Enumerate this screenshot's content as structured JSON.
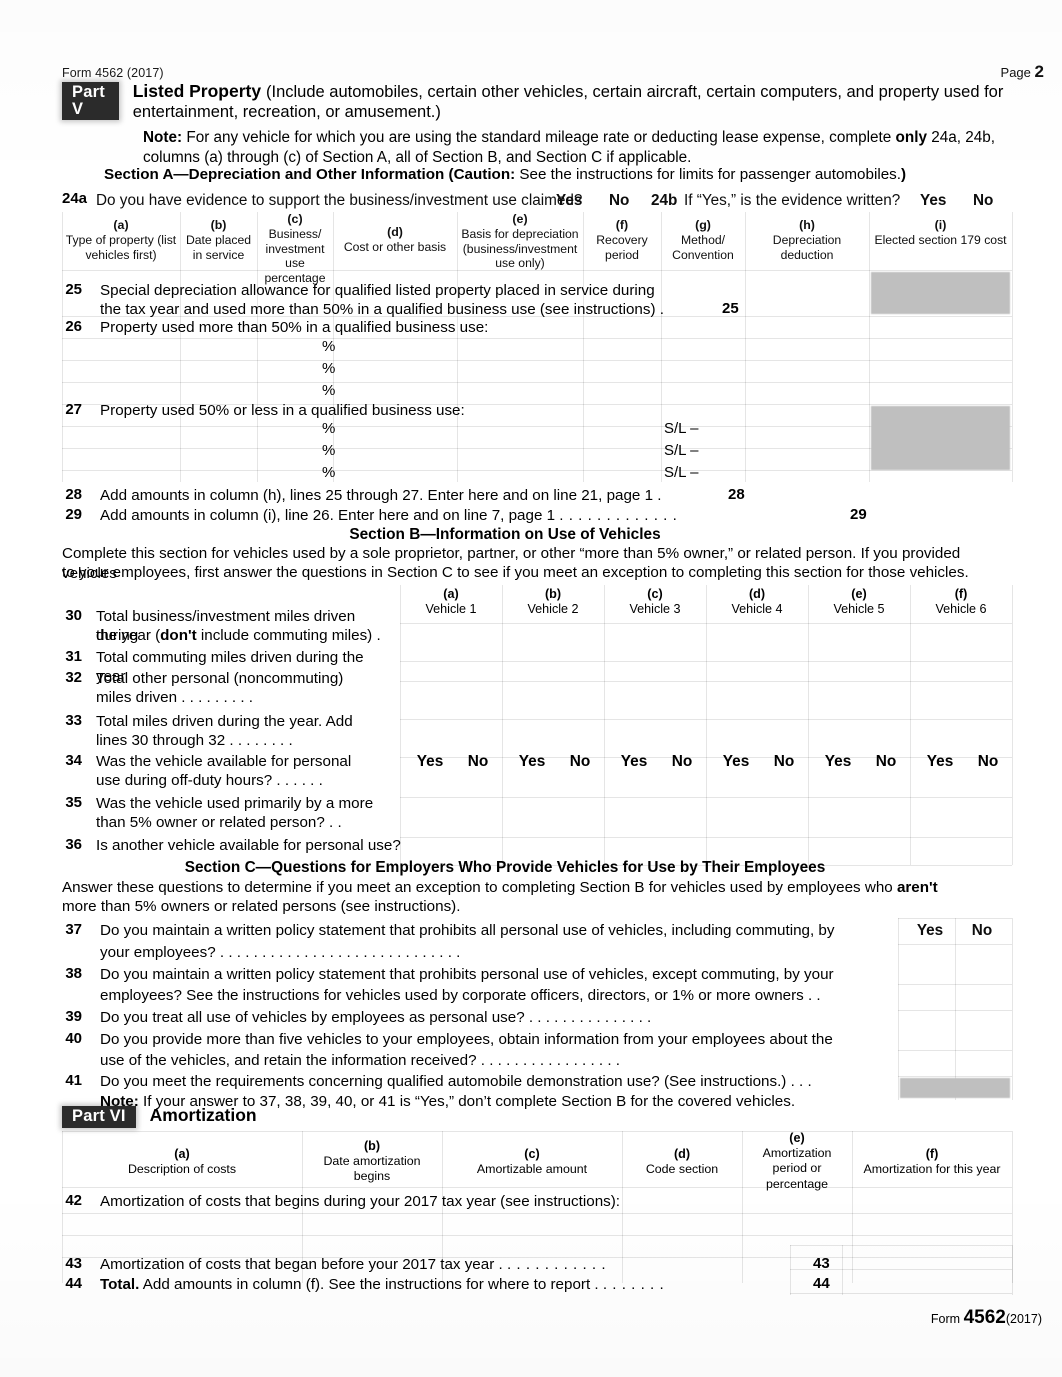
{
  "header": {
    "form_ref": "Form 4562 (2017)",
    "page_label": "Page",
    "page_number": "2"
  },
  "part_v": {
    "badge": "Part V",
    "title": "Listed Property",
    "title_rest": "(Include automobiles, certain other vehicles, certain aircraft, certain computers, and property used for entertainment, recreation, or amusement.)",
    "note_label": "Note:",
    "note_text_1": "For any vehicle for which you are using the standard mileage rate or deducting lease expense, complete",
    "note_bold_only": "only",
    "note_text_2": "24a, 24b, columns (a) through (c) of Section A, all of Section B, and Section C if applicable."
  },
  "section_a": {
    "heading_bold": "Section A—Depreciation and Other Information (Caution:",
    "heading_rest": "See the instructions for limits for passenger automobiles.",
    "heading_close": ")",
    "line24a_num": "24a",
    "line24a_text": "Do you have evidence to support the business/investment use claimed?",
    "line24a_yes": "Yes",
    "line24a_no": "No",
    "line24b_num": "24b",
    "line24b_text": "If “Yes,” is the evidence written?",
    "line24b_yes": "Yes",
    "line24b_no": "No",
    "columns": [
      {
        "letter": "(a)",
        "title": "Type of property (list vehicles first)"
      },
      {
        "letter": "(b)",
        "title": "Date placed in service"
      },
      {
        "letter": "(c)",
        "title": "Business/ investment use percentage"
      },
      {
        "letter": "(d)",
        "title": "Cost or other basis"
      },
      {
        "letter": "(e)",
        "title": "Basis for depreciation (business/investment use only)"
      },
      {
        "letter": "(f)",
        "title": "Recovery period"
      },
      {
        "letter": "(g)",
        "title": "Method/ Convention"
      },
      {
        "letter": "(h)",
        "title": "Depreciation deduction"
      },
      {
        "letter": "(i)",
        "title": "Elected section 179 cost"
      }
    ],
    "line25_num": "25",
    "line25_text_a": "Special depreciation allowance for qualified listed property placed in service during",
    "line25_text_b": "the tax  year and used more than 50% in a qualified business use (see instructions) .",
    "line25_box": "25",
    "line26_num": "26",
    "line26_text": "Property used more than 50% in a qualified business use:",
    "line27_num": "27",
    "line27_text": "Property used 50% or less in a qualified business use:",
    "percent_sign": "%",
    "sl_mark": "S/L –",
    "line28_num": "28",
    "line28_text": "Add amounts in column (h), lines 25 through 27. Enter here and on line 21, page 1   .",
    "line28_box": "28",
    "line29_num": "29",
    "line29_text": "Add amounts in column (i), line 26. Enter here and on line 7, page 1",
    "line29_leaders": ".  .  .  .  .  .  .  .  .  .  .  .  .",
    "line29_box": "29"
  },
  "section_b": {
    "heading": "Section B—Information on Use of Vehicles",
    "intro_1": "Complete this section for vehicles used by a sole proprietor, partner, or other “more than 5% owner,” or related person. If you provided vehicles",
    "intro_2": "to your employees, first answer the questions in Section C to see if you meet an exception to completing this section for those vehicles.",
    "columns": [
      {
        "letter": "(a)",
        "title": "Vehicle 1"
      },
      {
        "letter": "(b)",
        "title": "Vehicle 2"
      },
      {
        "letter": "(c)",
        "title": "Vehicle 3"
      },
      {
        "letter": "(d)",
        "title": "Vehicle 4"
      },
      {
        "letter": "(e)",
        "title": "Vehicle 5"
      },
      {
        "letter": "(f)",
        "title": "Vehicle 6"
      }
    ],
    "rows": [
      {
        "num": "30",
        "line1": "Total business/investment miles driven during",
        "line2_pre": "the year (",
        "line2_bold": "don't",
        "line2_post": " include commuting miles)    ."
      },
      {
        "num": "31",
        "line1": "Total commuting miles driven during the year",
        "line2_pre": "",
        "line2_bold": "",
        "line2_post": ""
      },
      {
        "num": "32",
        "line1": "Total   other   personal   (noncommuting)",
        "line2_pre": "miles driven    .    .    .    .    .    .    .    .    .",
        "line2_bold": "",
        "line2_post": ""
      },
      {
        "num": "33",
        "line1": "Total  miles  driven  during  the  year.  Add",
        "line2_pre": "lines 30 through 32   .    .    .    .    .    .    .    .",
        "line2_bold": "",
        "line2_post": ""
      },
      {
        "num": "34",
        "line1": "Was  the  vehicle  available  for  personal",
        "line2_pre": "use during off-duty hours? .    .    .    .    .    .",
        "line2_bold": "",
        "line2_post": ""
      },
      {
        "num": "35",
        "line1": "Was the vehicle used primarily by a more",
        "line2_pre": "than 5% owner or related person?    .    .",
        "line2_bold": "",
        "line2_post": ""
      },
      {
        "num": "36",
        "line1": "Is another vehicle available for personal use?",
        "line2_pre": "",
        "line2_bold": "",
        "line2_post": ""
      }
    ],
    "yes": "Yes",
    "no": "No"
  },
  "section_c": {
    "heading": "Section C—Questions for Employers Who Provide Vehicles for Use by Their Employees",
    "intro_1_pre": "Answer these questions to determine if you meet an exception to completing Section B for vehicles used by employees who ",
    "intro_1_bold": "aren't",
    "intro_2": "more than 5% owners or related persons (see instructions).",
    "yes": "Yes",
    "no": "No",
    "rows": [
      {
        "num": "37",
        "line1": "Do you maintain a written policy statement that prohibits all personal use of vehicles, including commuting, by",
        "line2": "your employees? .    .    .    .    .    .    .    .    .    .    .    .    .    .    .    .    .    .    .    .    .    .    .    .    .    .    .    .    ."
      },
      {
        "num": "38",
        "line1": "Do you maintain a written policy statement that prohibits personal use of vehicles, except commuting, by your",
        "line2": "employees?  See the instructions for vehicles used by corporate officers, directors, or 1% or more owners   .    ."
      },
      {
        "num": "39",
        "line1": "Do you treat all use of vehicles by employees as personal use?       .    .    .    .    .    .    .    .    .    .    .    .    .    .    .",
        "line2": ""
      },
      {
        "num": "40",
        "line1": "Do you provide more than five vehicles to your employees, obtain information from your employees about the",
        "line2": "use of the vehicles, and retain the information received? .    .    .    .    .    .    .    .    .    .    .    .    .    .    .    .    ."
      },
      {
        "num": "41",
        "line1": "Do you meet the requirements concerning qualified automobile demonstration use? (See instructions.)      .    .    .",
        "line2": ""
      }
    ],
    "note_label": "Note:",
    "note_text": "If your answer to 37, 38, 39, 40, or 41 is “Yes,” don’t complete Section B for the covered vehicles."
  },
  "part_vi": {
    "badge": "Part VI",
    "title": "Amortization",
    "columns": [
      {
        "letter": "(a)",
        "title": "Description of costs"
      },
      {
        "letter": "(b)",
        "title": "Date amortization begins"
      },
      {
        "letter": "(c)",
        "title": "Amortizable amount"
      },
      {
        "letter": "(d)",
        "title": "Code section"
      },
      {
        "letter": "(e)",
        "title": "Amortization period or percentage"
      },
      {
        "letter": "(f)",
        "title": "Amortization for this year"
      }
    ],
    "line42_num": "42",
    "line42_text": "Amortization of costs that begins during your 2017 tax year (see instructions):",
    "line43_num": "43",
    "line43_text": "Amortization of costs that began before your 2017 tax year .",
    "line43_leaders": ".    .    .    .    .    .    .    .    .    .    .",
    "line43_box": "43",
    "line44_num": "44",
    "line44_bold": "Total.",
    "line44_text": "Add amounts in column (f). See the instructions for where to report .",
    "line44_leaders": ".    .    .    .    .    .    .",
    "line44_box": "44"
  },
  "footer": {
    "form_word": "Form",
    "form_number": "4562",
    "form_year": "(2017)"
  },
  "colors": {
    "ink": "#0d0d0d",
    "badge_bg": "#2b2b2b",
    "shade": "#bfbfbf",
    "rule": "rgba(0,0,0,0.10)"
  }
}
